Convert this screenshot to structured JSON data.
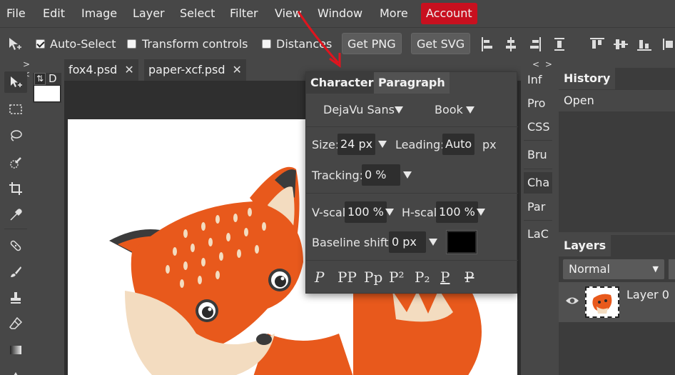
{
  "menu": {
    "items": [
      "File",
      "Edit",
      "Image",
      "Layer",
      "Select",
      "Filter",
      "View",
      "Window",
      "More"
    ],
    "account": "Account",
    "account_color": "#c8101f"
  },
  "options": {
    "auto_select": "Auto-Select",
    "auto_select_checked": true,
    "transform_controls": "Transform controls",
    "transform_controls_checked": false,
    "distances": "Distances",
    "distances_checked": false,
    "get_png": "Get PNG",
    "get_svg": "Get SVG"
  },
  "toolbar": {
    "collapse": "> <",
    "tools": [
      "move-tool",
      "marquee-tool",
      "lasso-tool",
      "quick-select-tool",
      "crop-tool",
      "eyedropper-tool",
      "healing-tool",
      "brush-tool",
      "stamp-tool",
      "eraser-tool",
      "gradient-tool"
    ]
  },
  "swatch": {
    "swap": "⇅",
    "default": "D",
    "primary_color": "#ffffff"
  },
  "doc_tabs": [
    {
      "name": "fox4.psd",
      "close": "✕"
    },
    {
      "name": "paper-xcf.psd",
      "close": "✕"
    }
  ],
  "character_panel": {
    "tab_character": "Character",
    "tab_paragraph": "Paragraph",
    "font_family": "DejaVu Sans",
    "font_style": "Book",
    "size_label": "Size:",
    "size_value": "24 px",
    "leading_label": "Leading:",
    "leading_value": "Auto",
    "leading_unit": "px",
    "tracking_label": "Tracking:",
    "tracking_value": "0 %",
    "vscale_label": "V-scal",
    "vscale_value": "100 %",
    "hscale_label": "H-scal",
    "hscale_value": "100 %",
    "baseline_label": "Baseline shift:",
    "baseline_value": "0 px",
    "color": "#000000",
    "style_buttons": [
      "P",
      "PP",
      "Pp",
      "P²",
      "P₂",
      "P",
      "P"
    ]
  },
  "right_strip": {
    "collapse": "< >",
    "items": [
      "Inf",
      "Pro",
      "CSS",
      "Bru",
      "Cha",
      "Par",
      "LaC"
    ],
    "active": "Cha"
  },
  "history": {
    "title": "History",
    "items": [
      "Open"
    ]
  },
  "layers": {
    "title": "Layers",
    "blend_mode": "Normal",
    "layer_name": "Layer 0"
  }
}
